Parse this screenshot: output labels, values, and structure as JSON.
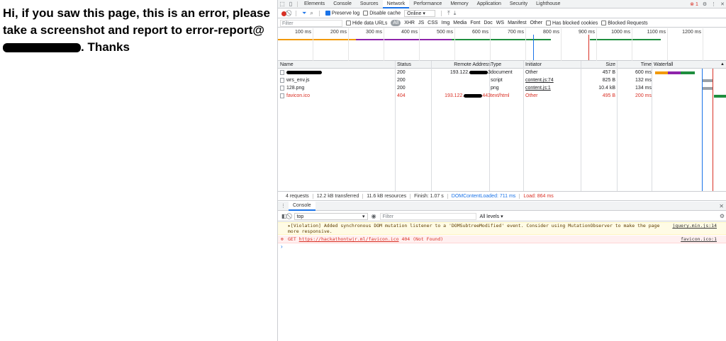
{
  "page": {
    "message_part1": "Hi, if you saw this page, this is an error, please take a screenshot and report to error-report@",
    "message_part2": ". Thanks"
  },
  "devtools": {
    "tabs": [
      "Elements",
      "Console",
      "Sources",
      "Network",
      "Performance",
      "Memory",
      "Application",
      "Security",
      "Lighthouse"
    ],
    "active_tab": "Network",
    "error_count": "1",
    "toolbar": {
      "preserve_log": "Preserve log",
      "disable_cache": "Disable cache",
      "throttling": "Online"
    },
    "filter": {
      "placeholder": "Filter",
      "hide_data_urls": "Hide data URLs",
      "all": "All",
      "types": [
        "XHR",
        "JS",
        "CSS",
        "Img",
        "Media",
        "Font",
        "Doc",
        "WS",
        "Manifest",
        "Other"
      ],
      "has_blocked_cookies": "Has blocked cookies",
      "blocked_requests": "Blocked Requests"
    },
    "overview_ticks": [
      "100 ms",
      "200 ms",
      "300 ms",
      "400 ms",
      "500 ms",
      "600 ms",
      "700 ms",
      "800 ms",
      "900 ms",
      "1000 ms",
      "1100 ms",
      "1200 ms",
      "1"
    ],
    "columns": [
      "Name",
      "Status",
      "Remote Address",
      "Type",
      "Initiator",
      "Size",
      "Time",
      "Waterfall"
    ],
    "requests": [
      {
        "name": "",
        "status": "200",
        "remote": "193.122.",
        "remote_suffix": "3",
        "type": "document",
        "initiator": "Other",
        "size": "457 B",
        "time": "600 ms",
        "error": false,
        "initiator_link": false
      },
      {
        "name": "wrs_env.js",
        "status": "200",
        "remote": "",
        "remote_suffix": "",
        "type": "script",
        "initiator": "content.js:74",
        "size": "825 B",
        "time": "132 ms",
        "error": false,
        "initiator_link": true
      },
      {
        "name": "128.png",
        "status": "200",
        "remote": "",
        "remote_suffix": "",
        "type": "png",
        "initiator": "content.js:1",
        "size": "10.4 kB",
        "time": "134 ms",
        "error": false,
        "initiator_link": true
      },
      {
        "name": "favicon.ico",
        "status": "404",
        "remote": "193.122.",
        "remote_suffix": "443",
        "type": "text/html",
        "initiator": "Other",
        "size": "495 B",
        "time": "200 ms",
        "error": true,
        "initiator_link": false
      }
    ],
    "summary": {
      "requests": "4 requests",
      "transferred": "12.2 kB transferred",
      "resources": "11.6 kB resources",
      "finish": "Finish: 1.07 s",
      "dcl": "DOMContentLoaded: 711 ms",
      "load": "Load: 864 ms"
    },
    "console": {
      "tab": "Console",
      "context": "top",
      "filter_placeholder": "Filter",
      "levels": "All levels ▾",
      "violation": "▸[Violation] Added synchronous DOM mutation listener to a 'DOMSubtreeModified' event. Consider using MutationObserver to make the page more responsive.",
      "violation_src": "jquery.min.js:14",
      "error_prefix": "GET ",
      "error_url": "https://hackathontwjr.ml/favicon.ico",
      "error_suffix": " 404 (Not Found)",
      "error_src": "favicon.ico:1",
      "prompt": "›"
    },
    "colors": {
      "accent": "#1a73e8",
      "error": "#d93025",
      "dcl": "#1a73e8",
      "load": "#d93025"
    }
  }
}
